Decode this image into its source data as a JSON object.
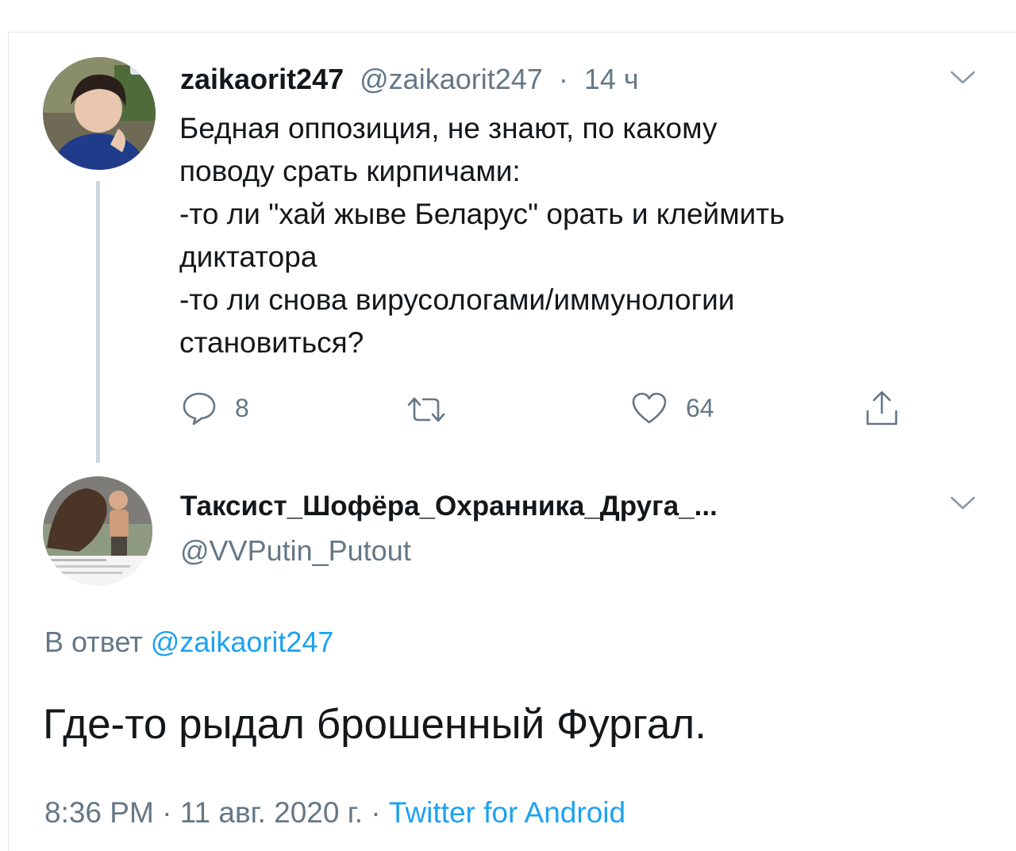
{
  "tweet": {
    "display_name": "zaikaorit247",
    "handle": "@zaikaorit247",
    "separator": "·",
    "time": "14 ч",
    "text": "Бедная оппозиция, не знают, по какому\nповоду срать кирпичами:\n-то ли \"хай жыве Беларус\" орать и клеймить\nдиктатора\n-то ли снова вирусологами/иммунологии\nстановиться?",
    "actions": {
      "reply_count": "8",
      "retweet_count": "",
      "like_count": "64"
    }
  },
  "reply": {
    "display_name": "Таксист_Шофёра_Охранника_Друга_...",
    "handle": "@VVPutin_Putout",
    "replying_prefix": "В ответ",
    "replying_to": "@zaikaorit247",
    "text": "Где-то рыдал брошенный Фургал.",
    "time": "8:36 PM",
    "date": "11 авг. 2020 г.",
    "separator": "·",
    "source": "Twitter for Android"
  },
  "icons": {
    "more": "chevron-down-icon",
    "reply": "comment-icon",
    "retweet": "retweet-icon",
    "like": "heart-icon",
    "share": "share-icon"
  },
  "colors": {
    "text": "#14171a",
    "secondary": "#657786",
    "link": "#1da1f2",
    "divider": "#ccd6dd"
  }
}
